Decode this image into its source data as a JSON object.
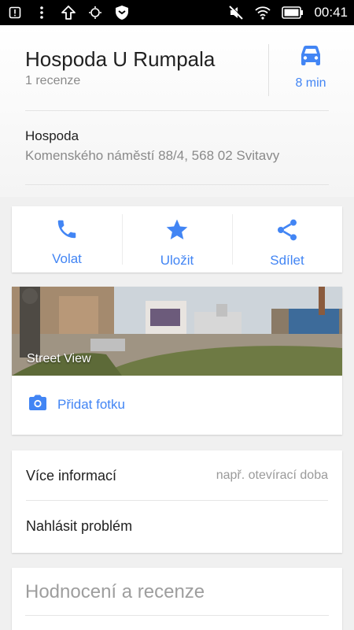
{
  "status_bar": {
    "time": "00:41",
    "left_icons": [
      "alert-icon",
      "dots-icon",
      "upload-icon",
      "radio-icon",
      "shield-icon"
    ],
    "right_icons": [
      "mute-icon",
      "wifi-icon",
      "battery-icon"
    ]
  },
  "place": {
    "name": "Hospoda U Rumpala",
    "reviews_count": "1 recenze",
    "drive_time": "8 min",
    "category": "Hospoda",
    "address": "Komenského náměstí 88/4, 568 02 Svitavy"
  },
  "actions": [
    {
      "label": "Volat",
      "icon": "phone-icon"
    },
    {
      "label": "Uložit",
      "icon": "star-icon"
    },
    {
      "label": "Sdílet",
      "icon": "share-icon"
    }
  ],
  "photo": {
    "street_view_label": "Street View",
    "add_photo_label": "Přidat fotku"
  },
  "info": {
    "more_info_label": "Více informací",
    "more_info_hint": "např. otevírací doba",
    "report_problem_label": "Nahlásit problém"
  },
  "reviews": {
    "title": "Hodnocení a recenze"
  },
  "colors": {
    "accent": "#4285f4",
    "text_primary": "#212121",
    "text_secondary": "#8a8a8a",
    "background": "#f0f0f0"
  }
}
